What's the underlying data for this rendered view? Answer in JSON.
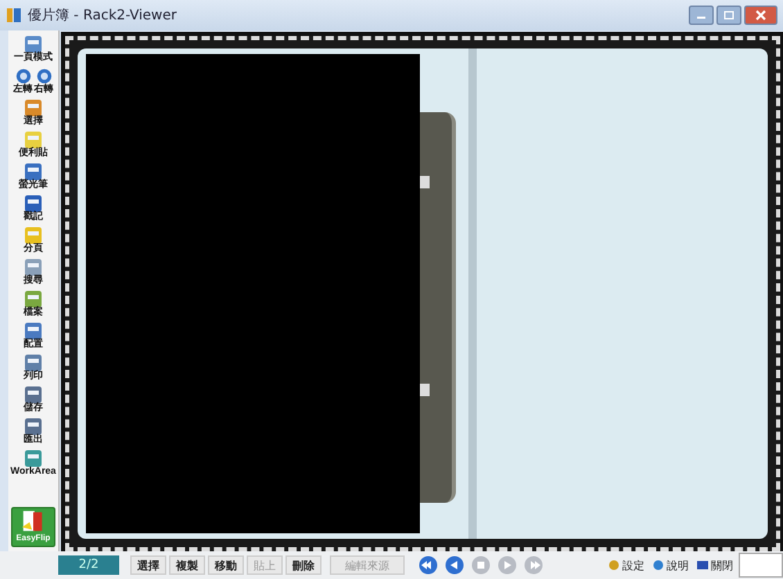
{
  "window": {
    "title": "優片簿 - Rack2-Viewer"
  },
  "sidebar": {
    "items": [
      {
        "label": "一頁模式"
      },
      {
        "kind": "pair",
        "items": [
          {
            "label": "左轉"
          },
          {
            "label": "右轉"
          }
        ]
      },
      {
        "label": "選擇"
      },
      {
        "label": "便利貼"
      },
      {
        "label": "螢光筆"
      },
      {
        "label": "戳記"
      },
      {
        "label": "分頁"
      },
      {
        "label": "搜尋"
      },
      {
        "label": "檔案"
      },
      {
        "label": "配置"
      },
      {
        "label": "列印"
      },
      {
        "label": "儲存"
      },
      {
        "label": "匯出"
      },
      {
        "label": "WorkArea"
      }
    ],
    "logo": {
      "label": "EasyFlip"
    }
  },
  "status_bar": {
    "page": "2/2",
    "edit_buttons": [
      {
        "label": "選擇",
        "disabled": false
      },
      {
        "label": "複製",
        "disabled": false
      },
      {
        "label": "移動",
        "disabled": false
      },
      {
        "label": "貼上",
        "disabled": true
      },
      {
        "label": "刪除",
        "disabled": false
      }
    ],
    "source_button": {
      "label": "編輯來源",
      "disabled": true
    },
    "nav_buttons": [
      {
        "kind": "first",
        "disabled": false
      },
      {
        "kind": "prev",
        "disabled": false
      },
      {
        "kind": "stop",
        "disabled": true
      },
      {
        "kind": "next",
        "disabled": true
      },
      {
        "kind": "last",
        "disabled": true
      }
    ],
    "links": [
      {
        "label": "設定"
      },
      {
        "label": "說明"
      },
      {
        "label": "關閉"
      }
    ]
  }
}
